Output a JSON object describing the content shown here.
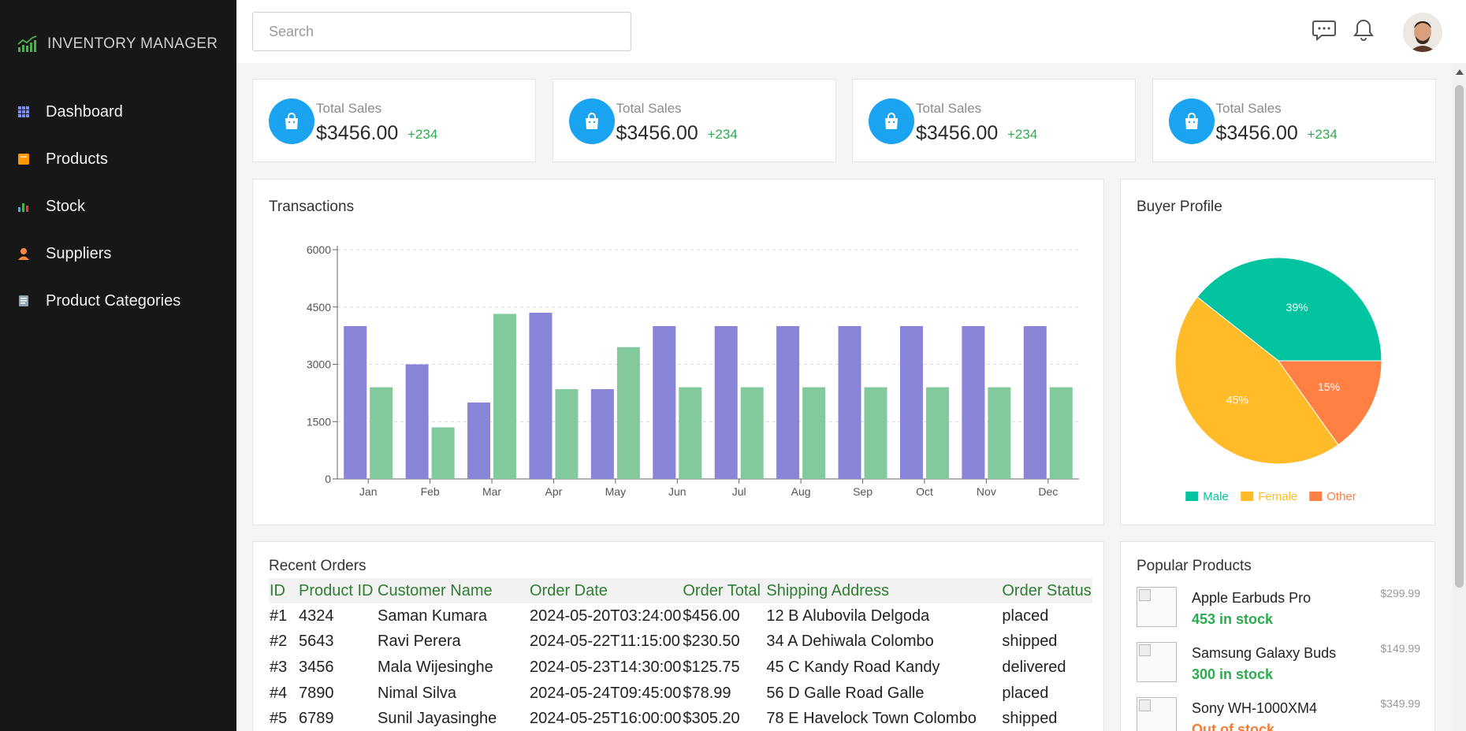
{
  "app": {
    "title": "INVENTORY MANAGER"
  },
  "sidebar": {
    "items": [
      {
        "label": "Dashboard",
        "icon": "grid-icon",
        "color": "#7b8cff"
      },
      {
        "label": "Products",
        "icon": "box-icon",
        "color": "#ff9800"
      },
      {
        "label": "Stock",
        "icon": "bar-chart-icon",
        "color": "#29b6f6"
      },
      {
        "label": "Suppliers",
        "icon": "person-icon",
        "color": "#ff8a3d"
      },
      {
        "label": "Product Categories",
        "icon": "document-icon",
        "color": "#90a4ae"
      }
    ]
  },
  "topbar": {
    "search_placeholder": "Search",
    "icons": [
      "chat-icon",
      "bell-icon",
      "avatar"
    ]
  },
  "stats": [
    {
      "label": "Total Sales",
      "value": "$3456.00",
      "delta": "+234"
    },
    {
      "label": "Total Sales",
      "value": "$3456.00",
      "delta": "+234"
    },
    {
      "label": "Total Sales",
      "value": "$3456.00",
      "delta": "+234"
    },
    {
      "label": "Total Sales",
      "value": "$3456.00",
      "delta": "+234"
    }
  ],
  "transactions": {
    "title": "Transactions",
    "chart_data": {
      "type": "bar",
      "categories": [
        "Jan",
        "Feb",
        "Mar",
        "Apr",
        "May",
        "Jun",
        "Jul",
        "Aug",
        "Sep",
        "Oct",
        "Nov",
        "Dec"
      ],
      "series": [
        {
          "values": [
            4000,
            3000,
            2000,
            4350,
            2350,
            4000,
            4000,
            4000,
            4000,
            4000,
            4000,
            4000
          ],
          "color": "#8884d8"
        },
        {
          "values": [
            2400,
            1350,
            4320,
            2350,
            3450,
            2400,
            2400,
            2400,
            2400,
            2400,
            2400,
            2400
          ],
          "color": "#82ca9d"
        }
      ],
      "ylim": [
        0,
        6000
      ],
      "yticks": [
        0,
        1500,
        3000,
        4500,
        6000
      ],
      "grid": true
    }
  },
  "buyer_profile": {
    "title": "Buyer Profile",
    "chart_data": {
      "type": "pie",
      "slices": [
        {
          "label": "Male",
          "value": 39,
          "color": "#00c49f"
        },
        {
          "label": "Female",
          "value": 45,
          "color": "#ffbb28"
        },
        {
          "label": "Other",
          "value": 15,
          "color": "#ff8042"
        }
      ],
      "legend": "bottom"
    }
  },
  "recent_orders": {
    "title": "Recent Orders",
    "columns": [
      "ID",
      "Product ID",
      "Customer Name",
      "Order Date",
      "Order Total",
      "Shipping Address",
      "Order Status"
    ],
    "rows": [
      [
        "#1",
        "4324",
        "Saman Kumara",
        "2024-05-20T03:24:00",
        "$456.00",
        "12 B Alubovila Delgoda",
        "placed"
      ],
      [
        "#2",
        "5643",
        "Ravi Perera",
        "2024-05-22T11:15:00",
        "$230.50",
        "34 A Dehiwala Colombo",
        "shipped"
      ],
      [
        "#3",
        "3456",
        "Mala Wijesinghe",
        "2024-05-23T14:30:00",
        "$125.75",
        "45 C Kandy Road Kandy",
        "delivered"
      ],
      [
        "#4",
        "7890",
        "Nimal Silva",
        "2024-05-24T09:45:00",
        "$78.99",
        "56 D Galle Road Galle",
        "placed"
      ],
      [
        "#5",
        "6789",
        "Sunil Jayasinghe",
        "2024-05-25T16:00:00",
        "$305.20",
        "78 E Havelock Town Colombo",
        "shipped"
      ]
    ]
  },
  "popular_products": {
    "title": "Popular Products",
    "items": [
      {
        "name": "Apple Earbuds Pro",
        "stock": "453 in stock",
        "price": "$299.99",
        "stock_color": "#2cab4f"
      },
      {
        "name": "Samsung Galaxy Buds",
        "stock": "300 in stock",
        "price": "$149.99",
        "stock_color": "#2cab4f"
      },
      {
        "name": "Sony WH-1000XM4",
        "stock": "Out of stock",
        "price": "$349.99",
        "stock_color": "#f57c34"
      }
    ]
  }
}
